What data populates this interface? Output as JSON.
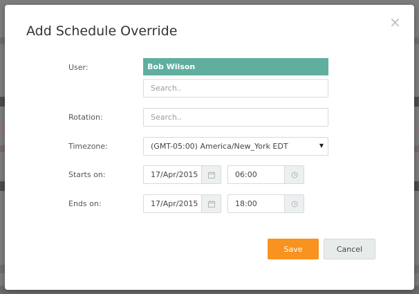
{
  "dialog": {
    "title": "Add Schedule Override",
    "close_glyph": "×"
  },
  "form": {
    "user": {
      "label": "User:",
      "selected": "Bob Wilson",
      "search_placeholder": "Search.."
    },
    "rotation": {
      "label": "Rotation:",
      "search_placeholder": "Search.."
    },
    "timezone": {
      "label": "Timezone:",
      "value": "(GMT-05:00) America/New_York EDT"
    },
    "starts_on": {
      "label": "Starts on:",
      "date": "17/Apr/2015",
      "time": "06:00"
    },
    "ends_on": {
      "label": "Ends on:",
      "date": "17/Apr/2015",
      "time": "18:00"
    }
  },
  "buttons": {
    "save": "Save",
    "cancel": "Cancel"
  },
  "colors": {
    "user_chip": "#5fae9e",
    "save_button": "#f7931e",
    "addon_bg": "#ecf0f1"
  },
  "icons": {
    "calendar": "calendar-icon",
    "clock": "clock-icon",
    "select": "chevron-down-icon"
  }
}
